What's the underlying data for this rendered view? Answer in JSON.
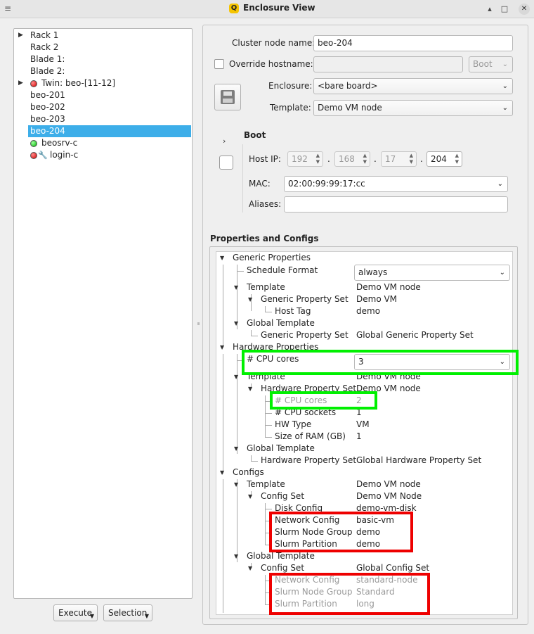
{
  "window": {
    "title": "Enclosure View",
    "app_icon": "Q"
  },
  "tree": {
    "items": [
      {
        "label": "Rack 1",
        "expandable": true
      },
      {
        "label": "Rack 2"
      },
      {
        "label": "Blade 1:"
      },
      {
        "label": "Blade 2:"
      },
      {
        "label": "Twin: beo-[11-12]",
        "expandable": true,
        "status": "red"
      },
      {
        "label": "beo-201"
      },
      {
        "label": "beo-202"
      },
      {
        "label": "beo-203"
      },
      {
        "label": "beo-204",
        "selected": true
      },
      {
        "label": "beosrv-c",
        "status": "green"
      },
      {
        "label": "login-c",
        "status": "red",
        "tool": true
      }
    ],
    "execute_label": "Execute",
    "selection_label": "Selection"
  },
  "form": {
    "cluster_node_name_label": "Cluster node name:",
    "cluster_node_name_value": "beo-204",
    "override_hostname_label": "Override hostname:",
    "boot_combo": "Boot",
    "enclosure_label": "Enclosure:",
    "enclosure_value": "<bare board>",
    "template_label": "Template:",
    "template_value": "Demo VM node"
  },
  "boot": {
    "title": "Boot",
    "host_ip_label": "Host IP:",
    "ip": [
      "192",
      "168",
      "17",
      "204"
    ],
    "dot": ".",
    "mac_label": "MAC:",
    "mac_value": "02:00:99:99:17:cc",
    "aliases_label": "Aliases:"
  },
  "properties": {
    "title": "Properties and Configs",
    "rows": [
      {
        "name": "Generic Properties",
        "value": ""
      },
      {
        "name": "Schedule Format",
        "value": "always"
      },
      {
        "name": "Template",
        "value": "Demo VM node"
      },
      {
        "name": "Generic Property Set",
        "value": "Demo VM"
      },
      {
        "name": "Host Tag",
        "value": "demo"
      },
      {
        "name": "Global Template",
        "value": ""
      },
      {
        "name": "Generic Property Set",
        "value": "Global Generic Property Set"
      },
      {
        "name": "Hardware Properties",
        "value": ""
      },
      {
        "name": "# CPU cores",
        "value": "3"
      },
      {
        "name": "Template",
        "value": "Demo VM node"
      },
      {
        "name": "Hardware Property Set",
        "value": "Demo VM node"
      },
      {
        "name": "# CPU cores",
        "value": "2"
      },
      {
        "name": "# CPU sockets",
        "value": "1"
      },
      {
        "name": "HW Type",
        "value": "VM"
      },
      {
        "name": "Size of RAM (GB)",
        "value": "1"
      },
      {
        "name": "Global Template",
        "value": ""
      },
      {
        "name": "Hardware Property Set",
        "value": "Global Hardware Property Set"
      },
      {
        "name": "Configs",
        "value": ""
      },
      {
        "name": "Template",
        "value": "Demo VM node"
      },
      {
        "name": "Config Set",
        "value": "Demo VM Node"
      },
      {
        "name": "Disk Config",
        "value": "demo-vm-disk"
      },
      {
        "name": "Network Config",
        "value": "basic-vm"
      },
      {
        "name": "Slurm Node Group",
        "value": "demo"
      },
      {
        "name": "Slurm Partition",
        "value": "demo"
      },
      {
        "name": "Global Template",
        "value": ""
      },
      {
        "name": "Config Set",
        "value": "Global Config Set"
      },
      {
        "name": "Network Config",
        "value": "standard-node"
      },
      {
        "name": "Slurm Node Group",
        "value": "Standard"
      },
      {
        "name": "Slurm Partition",
        "value": "long"
      }
    ]
  },
  "colors": {
    "selection": "#3daee9",
    "highlight_green": "#00f000",
    "highlight_red": "#ee0000"
  },
  "icons": [
    "menu-icon",
    "shade-icon",
    "maximize-icon",
    "close-icon",
    "save-icon",
    "expand-arrow-icon",
    "status-dot-icon",
    "wrench-icon",
    "chevron-down-icon"
  ]
}
